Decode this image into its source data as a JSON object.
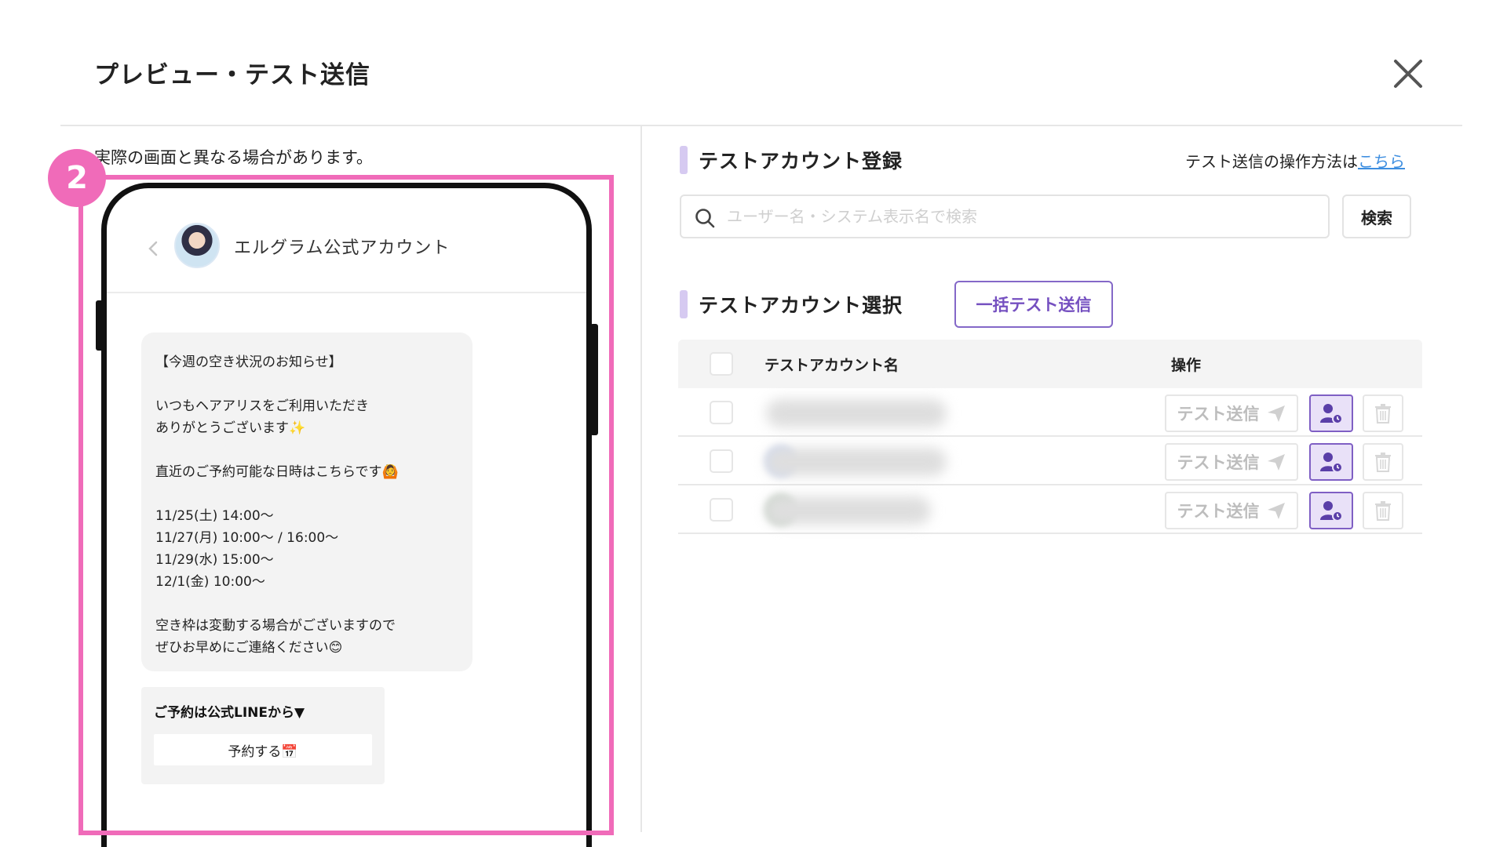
{
  "modal": {
    "title": "プレビュー・テスト送信"
  },
  "preview": {
    "note": "実際の画面と異なる場合があります。",
    "step_badge": "2",
    "chat": {
      "account_name": "エルグラム公式アカウント",
      "message_lines": [
        "【今週の空き状況のお知らせ】",
        "",
        "いつもヘアアリスをご利用いただき",
        "ありがとうございます✨",
        "",
        "直近のご予約可能な日時はこちらです🙆",
        "",
        "11/25(土) 14:00〜",
        "11/27(月) 10:00〜 / 16:00〜",
        "11/29(水) 15:00〜",
        "12/1(金) 10:00〜",
        "",
        "空き枠は変動する場合がございますので",
        "ぜひお早めにご連絡ください😊"
      ],
      "card_title": "ご予約は公式LINEから▼",
      "card_button": "予約する📅"
    }
  },
  "register": {
    "title": "テストアカウント登録",
    "help_prefix": "テスト送信の操作方法は",
    "help_link": "こちら",
    "search_placeholder": "ユーザー名・システム表示名で検索",
    "search_button": "検索"
  },
  "select": {
    "title": "テストアカウント選択",
    "bulk_button": "一括テスト送信",
    "columns": {
      "name": "テストアカウント名",
      "ops": "操作"
    },
    "rows": [
      {
        "send_label": "テスト送信"
      },
      {
        "send_label": "テスト送信"
      },
      {
        "send_label": "テスト送信"
      }
    ]
  },
  "colors": {
    "accent_pink": "#f06bb9",
    "accent_purple": "#7f5fc4",
    "section_bar": "#d6caf1",
    "link": "#3d8ee0"
  },
  "icons": [
    "close-icon",
    "chevron-left-icon",
    "search-icon",
    "send-icon",
    "user-clock-icon",
    "trash-icon"
  ]
}
